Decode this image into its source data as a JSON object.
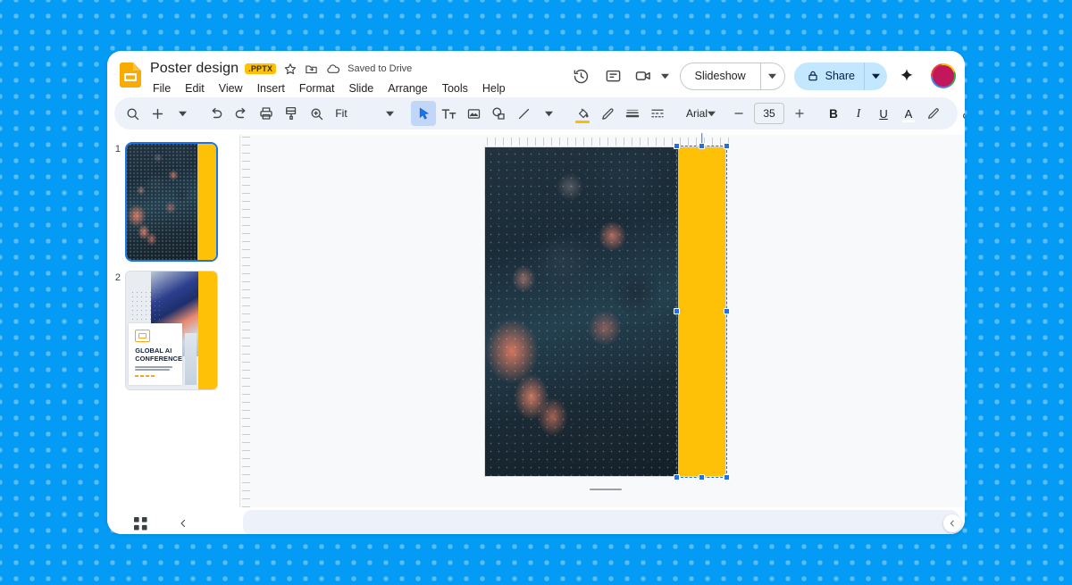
{
  "app": {
    "name": "Google Slides",
    "logo_icon": "slides-logo-icon"
  },
  "header": {
    "doc_title": "Poster design",
    "file_type_badge": ".PPTX",
    "star_icon": "star-icon",
    "move_icon": "move-to-folder-icon",
    "cloud_icon": "cloud-saved-icon",
    "save_status": "Saved to Drive",
    "menus": [
      "File",
      "Edit",
      "View",
      "Insert",
      "Format",
      "Slide",
      "Arrange",
      "Tools",
      "Help"
    ],
    "right": {
      "history_icon": "version-history-icon",
      "comment_icon": "comment-icon",
      "meet_icon": "meet-camera-icon",
      "meet_caret_icon": "chevron-down-icon",
      "slideshow_label": "Slideshow",
      "slideshow_caret_icon": "chevron-down-icon",
      "share_lock_icon": "lock-icon",
      "share_label": "Share",
      "share_caret_icon": "chevron-down-icon",
      "sparkle_icon": "gemini-sparkle-icon",
      "avatar_icon": "user-avatar"
    }
  },
  "toolbar": {
    "search_icon": "search-icon",
    "add_icon": "plus-icon",
    "add_caret_icon": "chevron-down-icon",
    "undo_icon": "undo-icon",
    "redo_icon": "redo-icon",
    "print_icon": "print-icon",
    "paint_format_icon": "paint-format-icon",
    "zoom_icon": "zoom-icon",
    "zoom_label": "Fit",
    "zoom_caret_icon": "chevron-down-icon",
    "select_icon": "cursor-select-icon",
    "textbox_icon": "text-box-icon",
    "image_icon": "insert-image-icon",
    "shape_icon": "shape-icon",
    "line_icon": "line-icon",
    "line_caret_icon": "chevron-down-icon",
    "fill_color_icon": "fill-color-icon",
    "fill_color_value": "#FBBC04",
    "border_color_icon": "border-color-icon",
    "border_weight_icon": "border-weight-icon",
    "border_dash_icon": "border-dash-icon",
    "font_name": "Arial",
    "font_caret_icon": "chevron-down-icon",
    "font_size_decrease": "−",
    "font_size": "35",
    "font_size_increase": "+",
    "bold_label": "B",
    "italic_label": "I",
    "underline_label": "U",
    "text_color_label": "A",
    "highlight_icon": "highlight-color-icon",
    "link_icon": "insert-link-icon",
    "comment_add_icon": "add-comment-icon",
    "more_icon": "more-options-icon",
    "collapse_icon": "collapse-toolbar-icon"
  },
  "filmstrip": {
    "slides": [
      {
        "number": "1",
        "selected": true,
        "name": "slide-thumbnail-1"
      },
      {
        "number": "2",
        "selected": false,
        "name": "slide-thumbnail-2"
      }
    ],
    "slide2_preview": {
      "title": "GLOBAL AI\nCONFERENCE",
      "logo_icon": "conference-logo-icon"
    }
  },
  "canvas": {
    "ruler_horizontal": "horizontal-ruler",
    "ruler_vertical": "vertical-ruler",
    "slide_image_name": "circuit-board-photo",
    "selected_shape": {
      "name": "yellow-rectangle-shape",
      "fill": "#FFC107",
      "selected": true,
      "handles": 8
    }
  },
  "bottom": {
    "grid_view_icon": "grid-view-icon",
    "collapse_filmstrip_icon": "collapse-filmstrip-icon",
    "notes_panel_name": "speaker-notes-panel",
    "notes_collapse_icon": "chevron-left-icon"
  }
}
